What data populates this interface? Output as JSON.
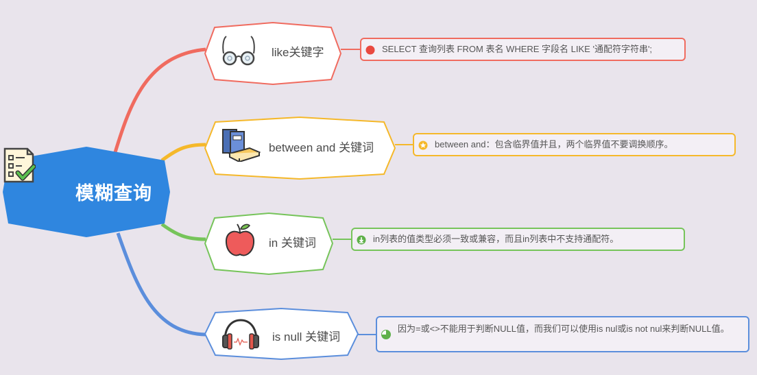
{
  "root": {
    "label": "模糊查询",
    "icon": "checklist-icon",
    "color": "#2f86df"
  },
  "topics": [
    {
      "label": "like关键字",
      "icon": "glasses-icon",
      "color": "#f06b5f",
      "note": {
        "text": "SELECT 查询列表 FROM 表名 WHERE 字段名 LIKE '通配符字符串';",
        "icon": "red-dot-icon"
      }
    },
    {
      "label": "between and 关键词",
      "icon": "books-icon",
      "color": "#f5b82a",
      "note": {
        "text": "between and：包含临界值并且，两个临界值不要调换顺序。",
        "icon": "star-badge-icon"
      }
    },
    {
      "label": "in 关键词",
      "icon": "apple-icon",
      "color": "#76c45a",
      "note": {
        "text": "in列表的值类型必须一致或兼容，而且in列表中不支持通配符。",
        "icon": "download-badge-icon"
      }
    },
    {
      "label": "is null 关键词",
      "icon": "headphones-icon",
      "color": "#5b8edc",
      "note": {
        "text": "因为=或<>不能用于判断NULL值，而我们可以使用is nul或is not nul来判断NULL值。",
        "icon": "progress-pie-icon"
      }
    }
  ]
}
